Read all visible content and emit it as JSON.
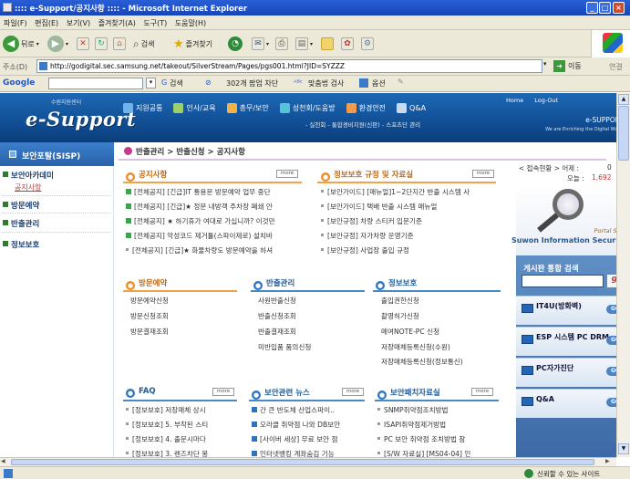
{
  "window": {
    "title": ":::: e-Support/공지사항 :::: - Microsoft Internet Explorer",
    "min": "_",
    "max": "□",
    "close": "×"
  },
  "menu": [
    "파일(F)",
    "편집(E)",
    "보기(V)",
    "즐겨찾기(A)",
    "도구(T)",
    "도움말(H)"
  ],
  "toolbar": {
    "back": "뒤로",
    "search": "검색",
    "favorites": "즐겨찾기"
  },
  "address": {
    "label": "주소(D)",
    "url": "http://godigital.sec.samsung.net/takeout/SilverStream/Pages/pgs001.html?JID=SYZZZ",
    "go": "이동",
    "links": "연결"
  },
  "google": {
    "label": "Google",
    "search": "검색",
    "blocked": "302개 팝업 차단",
    "spell": "맞춤법 검사",
    "options": "옵션"
  },
  "header": {
    "logo": "e-Support",
    "logo_sub": "수원지원센터",
    "nav": [
      "지원공통",
      "인사/교육",
      "총무/보안",
      "성천회/도움방",
      "환경안전",
      "Q&A"
    ],
    "subnav": "- 실천회 - 통합경비지원(신판) - 스포츠단 관리",
    "home": "Home",
    "logout": "Log-Out",
    "brand": "e-SUPPORT",
    "brand_sub": "We are Enriching the Digital World",
    "nav_colors": [
      "#6fb3e8",
      "#9dd06b",
      "#f2b347",
      "#57c3d9",
      "#f39b4a",
      "#c9d9ef"
    ]
  },
  "sidebar": {
    "title": "보안포탈(SISP)",
    "items": [
      "보안아카데미",
      "방문예약",
      "반출관리",
      "정보보호"
    ],
    "sub": "공지사항"
  },
  "breadcrumb": "반출관리 > 반출신청 > 공지사항",
  "notice": {
    "title": "공지사항",
    "more": "more",
    "rows": [
      "[전체공지] [긴급]IT 통용문 방문예약 업무 중단",
      "[전체공지] [긴급]★ 정문 내방객 주차장 폐쇄 안",
      "[전체공지] ★ 하기휴가 여대로 가십니까? 이것만",
      "[전체공지] 악성코드 제거툴(스파이제로) 설치바",
      "[전체공지] [긴급]★ 화물차량도 방문예약을 하셔"
    ]
  },
  "rules": {
    "title": "정보보호 규정 및 자료실",
    "more": "more",
    "rows": [
      "[보안가이드] [매뉴얼]1~2단지간 반출 시스템 사",
      "[보안가이드] 택배 반출 시스템 매뉴얼",
      "[보안규정] 차량 스티커 입문기준",
      "[보안규정] 자가차량 운영기준",
      "[보안규정] 사업장 출입 규정"
    ]
  },
  "access": {
    "label": "< 접속현황 > 어제 :",
    "yesterday": "0",
    "today_label": "오늘 :",
    "today": "1,692"
  },
  "visit": {
    "title": "방문예약",
    "rows": [
      "방문예약신청",
      "방문신청조회",
      "방문결재조회"
    ]
  },
  "carry": {
    "title": "반출관리",
    "rows": [
      "사원반출신청",
      "반출신청조회",
      "반출결재조회",
      "미반입품 품의신청"
    ]
  },
  "info": {
    "title": "정보보호",
    "rows": [
      "출입권한신청",
      "촬영허가신청",
      "메여NOTE-PC 신청",
      "저장매체등록신청(수원)",
      "저장매체등록신청(정보통신)"
    ]
  },
  "portal": {
    "small": "Portal Site",
    "name": "Suwon Information Security"
  },
  "board_search": {
    "label": "게시판 통합 검색",
    "go": "go"
  },
  "faq": {
    "title": "FAQ",
    "more": "more",
    "rows": [
      "[정보보호] 저장매체 상시",
      "[정보보호] 5. 부착된 스티",
      "[정보보호] 4. 출문시마다",
      "[정보보호] 3. 렌즈차단 봉"
    ]
  },
  "news": {
    "title": "보안관련 뉴스",
    "more": "more",
    "rows": [
      "간 큰 반도체 산업스파이..",
      "오라클 취약점 나와 DB보안",
      "[사이버 세상] 무료 보안 점",
      "인터넷뱅킹 계좌숨김 기능"
    ]
  },
  "patch": {
    "title": "보안패치자료실",
    "more": "more",
    "rows": [
      "SNMP취약점조치방법",
      "ISAPI취약점제거방법",
      "PC 보안 취약점 조치방법 참",
      "[S/W 자료실] [MS04-04] 인"
    ]
  },
  "quick": [
    {
      "label": "IT4U(방화벽)",
      "go": "GO"
    },
    {
      "label": "ESP 시스템 PC DRM",
      "go": "GO"
    },
    {
      "label": "PC자가진단",
      "go": "GO"
    },
    {
      "label": "Q&A",
      "go": "GO"
    }
  ],
  "status": {
    "text": "신뢰할 수 있는 사이트"
  }
}
